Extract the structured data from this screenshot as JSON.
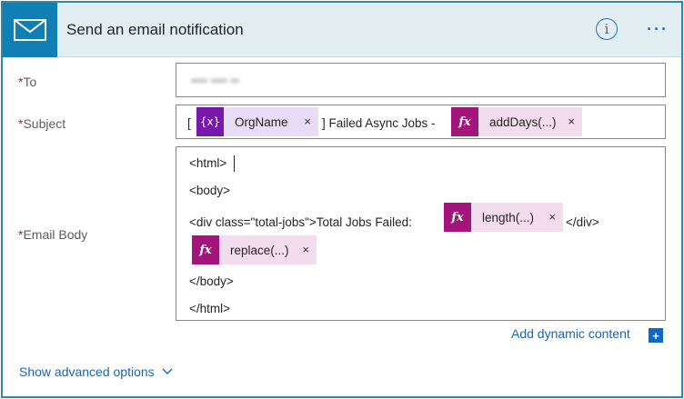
{
  "header": {
    "title": "Send an email notification",
    "icon": "mail-icon",
    "info_label": "i",
    "more_label": "···",
    "accent_color": "#0f7fb5"
  },
  "fields": {
    "required_mark": "*",
    "to": {
      "label": "To",
      "value": "•••• •••• ••"
    },
    "subject": {
      "label": "Subject",
      "prefix": "[",
      "tokens": [
        {
          "kind": "variable",
          "icon": "{x}",
          "label": "OrgName",
          "remove": "×"
        },
        {
          "kind": "expression",
          "icon": "fx",
          "label": "addDays(...)",
          "remove": "×"
        }
      ],
      "middle_text": "] Failed Async Jobs -"
    },
    "body": {
      "label": "Email Body",
      "lines": [
        "<html>",
        "<body>",
        "<div class=\"total-jobs\">Total Jobs Failed:",
        "</div>",
        "</body>",
        "</html>"
      ],
      "tokens": [
        {
          "kind": "expression",
          "icon": "fx",
          "label": "length(...)",
          "remove": "×"
        },
        {
          "kind": "expression",
          "icon": "fx",
          "label": "replace(...)",
          "remove": "×"
        }
      ]
    }
  },
  "actions": {
    "add_dynamic": "Add dynamic content",
    "add_dynamic_icon": "+",
    "show_advanced": "Show advanced options"
  }
}
